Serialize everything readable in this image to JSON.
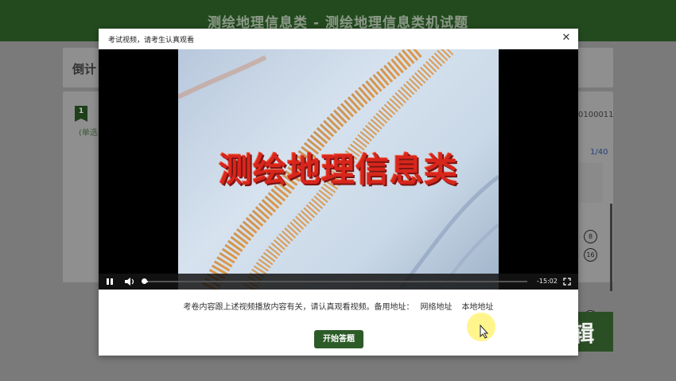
{
  "header": {
    "title": "测绘地理信息类 - 测绘地理信息类机试题"
  },
  "background": {
    "countdown_label": "倒计",
    "question_number": "1",
    "question_type": "(单选",
    "exam_id": "0100011",
    "progress": "1/40",
    "answer_circles": [
      "8",
      "16",
      "28"
    ]
  },
  "modal": {
    "title": "考试视频，请考生认真观看",
    "close_icon": "close-icon",
    "video": {
      "caption": "测绘地理信息类",
      "time_remaining": "-15:02",
      "progress_fraction": 0.01
    },
    "notice": "考卷内容跟上述视频播放内容有关，请认真观看视频。备用地址：",
    "links": {
      "network": "网络地址",
      "local": "本地地址"
    },
    "start_button": "开始答题"
  },
  "watermark": {
    "text": "/剪辑"
  },
  "colors": {
    "header": "#234a1f",
    "accent": "#2c5b27",
    "caption": "#d8261d"
  }
}
